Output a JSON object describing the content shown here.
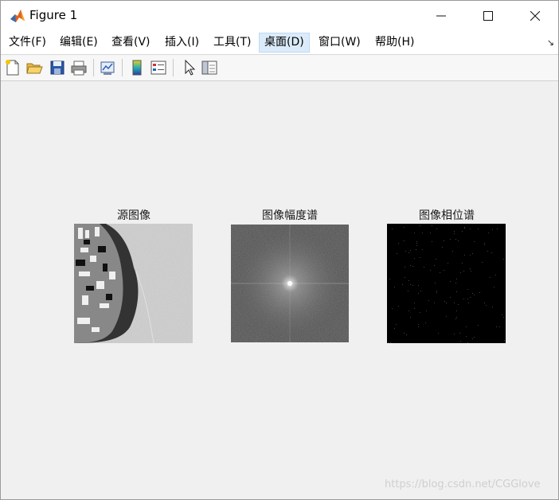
{
  "window": {
    "title": "Figure 1"
  },
  "menu": {
    "items": [
      {
        "label": "文件(F)"
      },
      {
        "label": "编辑(E)"
      },
      {
        "label": "查看(V)"
      },
      {
        "label": "插入(I)"
      },
      {
        "label": "工具(T)"
      },
      {
        "label": "桌面(D)",
        "active": true
      },
      {
        "label": "窗口(W)"
      },
      {
        "label": "帮助(H)"
      }
    ]
  },
  "toolbar": {
    "icons": [
      "new-file-icon",
      "open-folder-icon",
      "save-icon",
      "print-icon",
      "link-plot-icon",
      "colorbar-icon",
      "legend-icon",
      "pointer-icon",
      "property-inspector-icon"
    ]
  },
  "plots": [
    {
      "title": "源图像",
      "content": "source satellite image"
    },
    {
      "title": "图像幅度谱",
      "content": "magnitude spectrum"
    },
    {
      "title": "图像相位谱",
      "content": "phase spectrum"
    }
  ],
  "watermark": "https://blog.csdn.net/CGGlove",
  "colors": {
    "background": "#f0f0f0",
    "active_menu": "#dcebfa"
  }
}
